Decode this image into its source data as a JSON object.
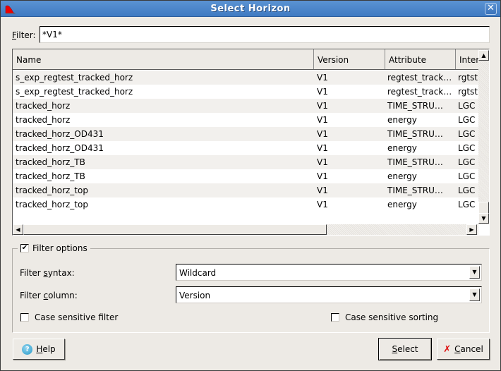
{
  "window": {
    "title": "Select Horizon",
    "app_icon": "app-logo-icon",
    "close_glyph": "✕"
  },
  "filter": {
    "label_mnemonic": "F",
    "label_rest": "ilter:",
    "value": "*V1*"
  },
  "table": {
    "columns": [
      "Name",
      "Version",
      "Attribute",
      "Inter"
    ],
    "rows": [
      {
        "name": "s_exp_regtest_tracked_horz",
        "version": "V1",
        "attribute": "regtest_track…",
        "inter": "rgtst"
      },
      {
        "name": "s_exp_regtest_tracked_horz",
        "version": "V1",
        "attribute": "regtest_track…",
        "inter": "rgtst"
      },
      {
        "name": "tracked_horz",
        "version": "V1",
        "attribute": "TIME_STRU…",
        "inter": "LGC"
      },
      {
        "name": "tracked_horz",
        "version": "V1",
        "attribute": "energy",
        "inter": "LGC"
      },
      {
        "name": "tracked_horz_OD431",
        "version": "V1",
        "attribute": "TIME_STRU…",
        "inter": "LGC"
      },
      {
        "name": "tracked_horz_OD431",
        "version": "V1",
        "attribute": "energy",
        "inter": "LGC"
      },
      {
        "name": "tracked_horz_TB",
        "version": "V1",
        "attribute": "TIME_STRU…",
        "inter": "LGC"
      },
      {
        "name": "tracked_horz_TB",
        "version": "V1",
        "attribute": "energy",
        "inter": "LGC"
      },
      {
        "name": "tracked_horz_top",
        "version": "V1",
        "attribute": "TIME_STRU…",
        "inter": "LGC"
      },
      {
        "name": "tracked_horz_top",
        "version": "V1",
        "attribute": "energy",
        "inter": "LGC"
      }
    ],
    "scroll_up_glyph": "▲",
    "scroll_down_glyph": "▼",
    "scroll_left_glyph": "◀",
    "scroll_right_glyph": "▶"
  },
  "filter_options": {
    "title": "Filter options",
    "enabled": true,
    "check_glyph": "✔",
    "syntax_label_pre": "Filter ",
    "syntax_label_mn": "s",
    "syntax_label_post": "yntax:",
    "syntax_value": "Wildcard",
    "column_label_pre": "Filter ",
    "column_label_mn": "c",
    "column_label_post": "olumn:",
    "column_value": "Version",
    "combo_arrow_glyph": "▼",
    "case_filter_label": "Case sensitive filter",
    "case_filter_checked": false,
    "case_sorting_label": "Case sensitive sorting",
    "case_sorting_checked": false
  },
  "buttons": {
    "help_mn": "H",
    "help_rest": "elp",
    "help_icon_glyph": "?",
    "select_mn": "S",
    "select_rest": "elect",
    "cancel_mn": "C",
    "cancel_rest": "ancel",
    "cancel_icon_glyph": "✗"
  }
}
